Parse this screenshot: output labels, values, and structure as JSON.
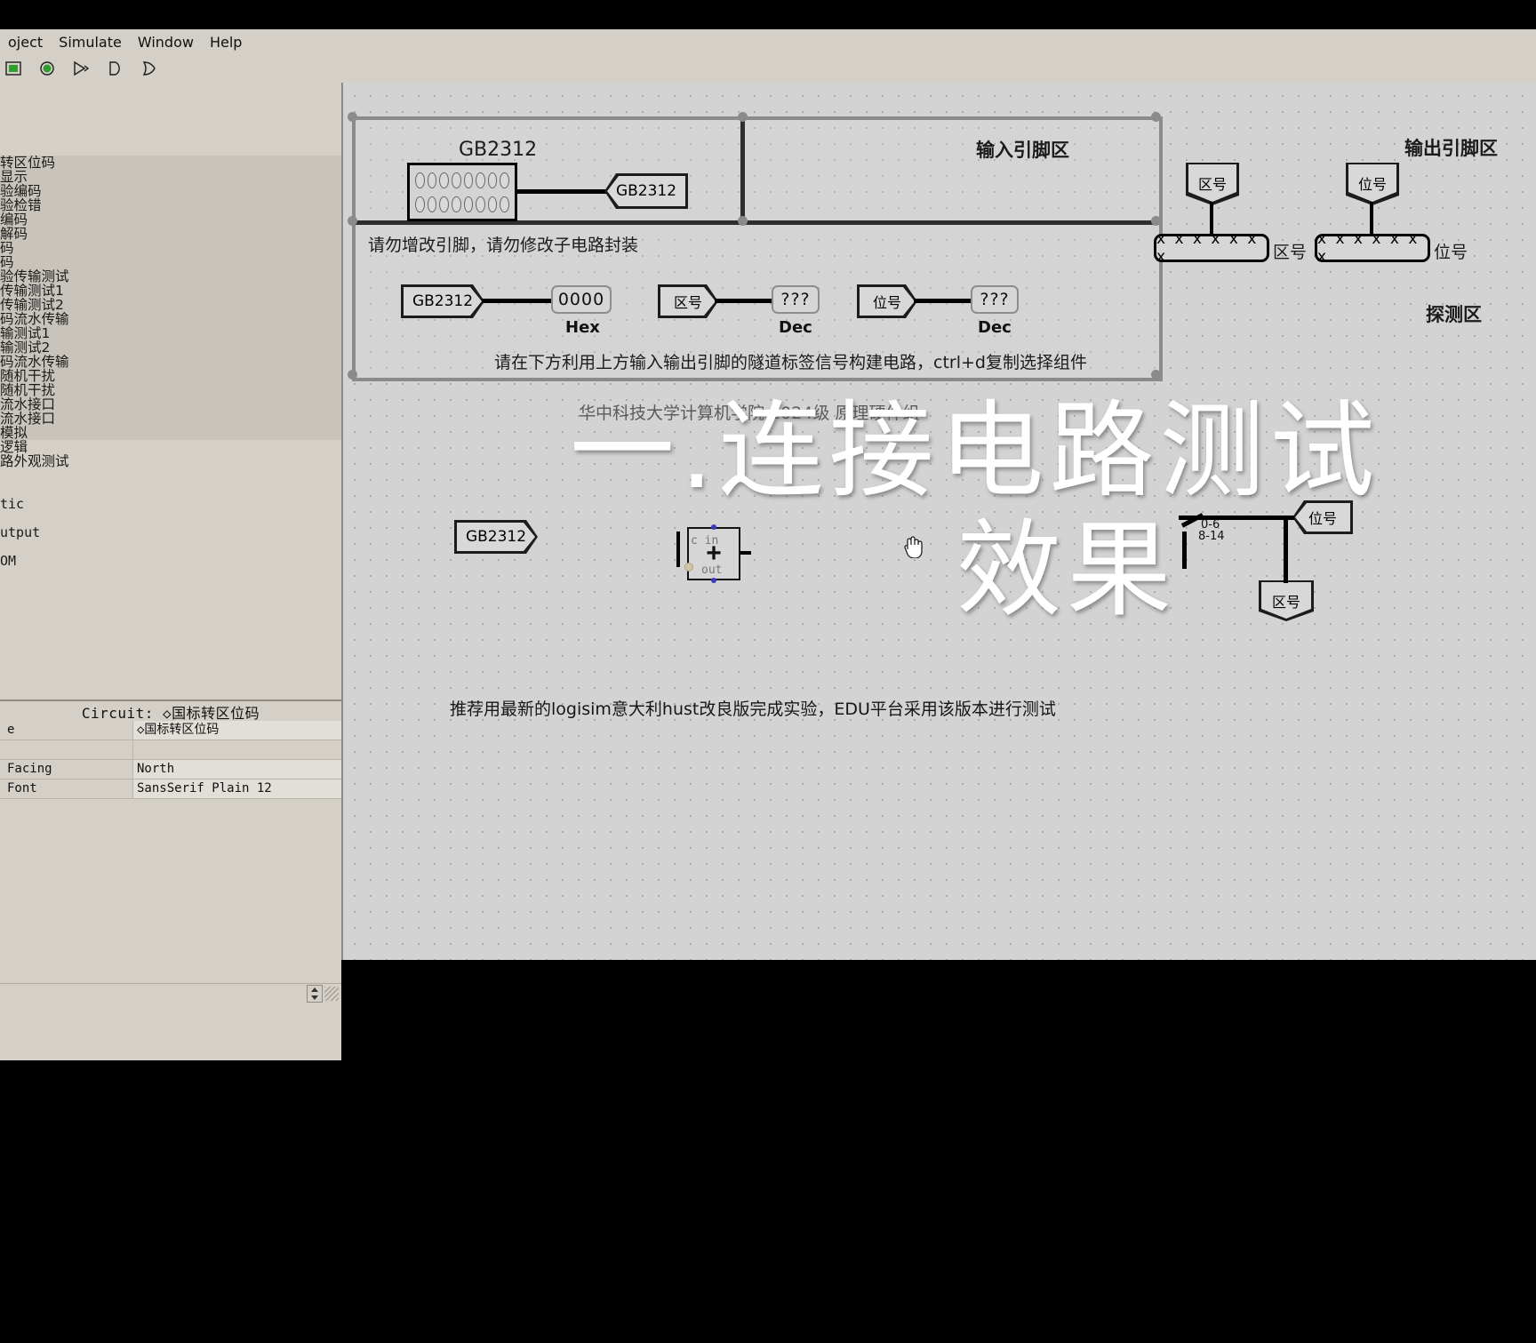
{
  "app": {
    "menu": [
      "oject",
      "Simulate",
      "Window",
      "Help"
    ],
    "toolbar_icons": [
      "poke-tool-icon",
      "select-tool-icon",
      "wiring-tool-icon",
      "not-gate-icon",
      "or-gate-icon"
    ]
  },
  "sidebar": {
    "tree_items": [
      "转区位码",
      "显示",
      "验编码",
      "验检错",
      "编码",
      "解码",
      "码",
      "码",
      "验传输测试",
      "传输测试1",
      "传输测试2",
      "码流水传输",
      "输测试1",
      "输测试2",
      "码流水传输",
      "随机干扰",
      "随机干扰",
      "流水接口",
      "流水接口",
      "模拟",
      "逻辑",
      "路外观测试"
    ],
    "library_items": [
      "tic",
      "utput",
      "OM"
    ]
  },
  "properties": {
    "title": "Circuit:  ◇国标转区位码",
    "rows": [
      {
        "key": "e",
        "value": "◇国标转区位码"
      },
      {
        "key": "",
        "value": ""
      },
      {
        "key": "Facing",
        "value": "North"
      },
      {
        "key": "Font",
        "value": "SansSerif Plain 12"
      }
    ]
  },
  "canvas": {
    "input_region": {
      "title": "输入引脚区",
      "pin_label": "GB2312",
      "pin_bits_top": [
        "0",
        "0",
        "0",
        "0",
        "0",
        "0",
        "0",
        "0"
      ],
      "pin_bits_bottom": [
        "0",
        "0",
        "0",
        "0",
        "0",
        "0",
        "0",
        "0"
      ],
      "tunnel_label": "GB2312",
      "note": "请勿增改引脚，请勿修改子电路封装"
    },
    "output_region": {
      "title": "输出引脚区",
      "pins": [
        {
          "tunnel": "区号",
          "value": "x x x x x x x",
          "label": "区号"
        },
        {
          "tunnel": "位号",
          "value": "x x x x x x x",
          "label": "位号"
        }
      ]
    },
    "probe_region": {
      "title": "探测区",
      "probes": [
        {
          "tunnel": "GB2312",
          "value": "0000",
          "radix": "Hex"
        },
        {
          "tunnel": "区号",
          "value": "???",
          "radix": "Dec"
        },
        {
          "tunnel": "位号",
          "value": "???",
          "radix": "Dec"
        }
      ],
      "note": "请在下方利用上方输入输出引脚的隧道标签信号构建电路，ctrl+d复制选择组件"
    },
    "work_area": {
      "tunnel_gb2312": "GB2312",
      "tunnel_weihao": "位号",
      "tunnel_quhao": "区号",
      "adder": {
        "cin": "c in",
        "out": "out",
        "op": "+"
      },
      "splitter_labels": [
        "0-6",
        "8-14"
      ]
    },
    "footer_note": "推荐用最新的logisim意大利hust改良版完成实验，EDU平台采用该版本进行测试",
    "hidden_note": "华中科技大学计算机学院 2024级 原理硬件组"
  },
  "watermark": {
    "line1": "一.连接电路测试",
    "line2": "效果"
  },
  "colors": {
    "window_bg": "#d4d0c8",
    "canvas_bg": "#d3d3d3",
    "frame": "#8b8b8b",
    "wire": "#000000",
    "accent_green": "#2f9e2f"
  }
}
